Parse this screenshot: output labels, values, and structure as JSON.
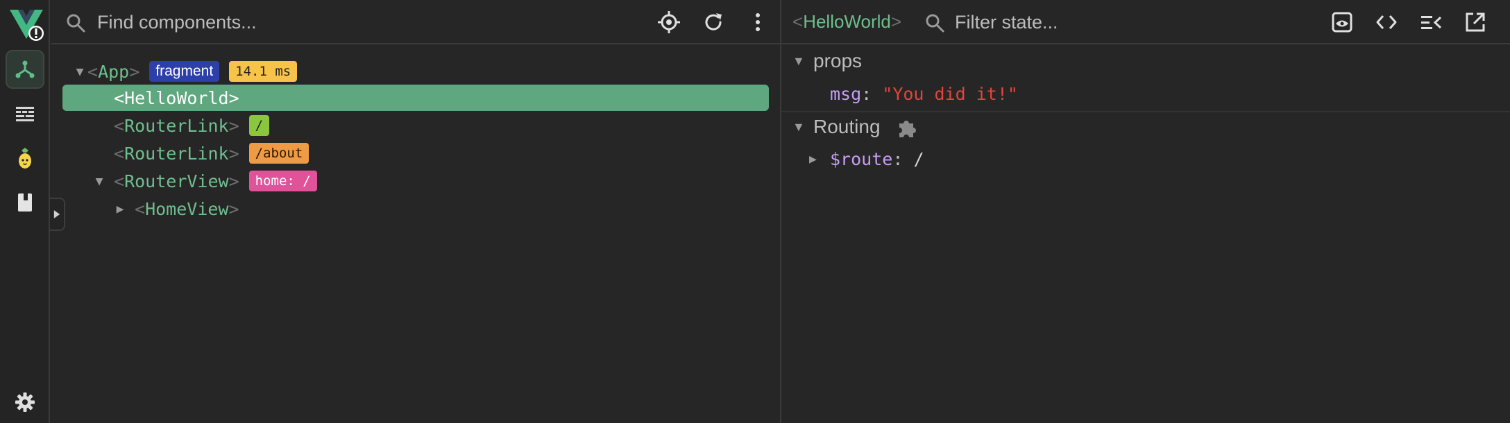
{
  "app": {
    "brand_color": "#42b883",
    "accent_green": "#5fa77e"
  },
  "activity_bar": {
    "items": [
      {
        "name": "components",
        "icon": "component-tree-icon",
        "active": true
      },
      {
        "name": "timeline",
        "icon": "timeline-icon",
        "active": false
      },
      {
        "name": "pinia",
        "icon": "pinia-icon",
        "active": false
      },
      {
        "name": "routes",
        "icon": "book-icon",
        "active": false
      },
      {
        "name": "settings",
        "icon": "gear-icon",
        "active": false
      }
    ]
  },
  "components_panel": {
    "search": {
      "placeholder": "Find components..."
    },
    "tree": [
      {
        "open": "<",
        "name": "App",
        "close": ">",
        "expanded": true,
        "badges": [
          {
            "text": "fragment",
            "kind": "fragment"
          },
          {
            "text": "14.1 ms",
            "kind": "time"
          }
        ]
      },
      {
        "open": "<",
        "name": "HelloWorld",
        "close": ">",
        "selected": true,
        "badges": []
      },
      {
        "open": "<",
        "name": "RouterLink",
        "close": ">",
        "badges": [
          {
            "text": "/",
            "kind": "green"
          }
        ]
      },
      {
        "open": "<",
        "name": "RouterLink",
        "close": ">",
        "badges": [
          {
            "text": "/about",
            "kind": "orange"
          }
        ]
      },
      {
        "open": "<",
        "name": "RouterView",
        "close": ">",
        "expanded": true,
        "badges": [
          {
            "text": "home: /",
            "kind": "pink"
          }
        ]
      },
      {
        "open": "<",
        "name": "HomeView",
        "close": ">",
        "expanded": false,
        "badges": []
      }
    ]
  },
  "state_panel": {
    "selected": {
      "open": "<",
      "name": "HelloWorld",
      "close": ">"
    },
    "filter": {
      "placeholder": "Filter state..."
    },
    "sections": [
      {
        "title": "props",
        "rows": [
          {
            "key": "msg",
            "colon": ":",
            "value": "\"You did it!\""
          }
        ]
      },
      {
        "title": "Routing",
        "rows": [
          {
            "key": "$route",
            "colon": ":",
            "value": "/"
          }
        ]
      }
    ]
  }
}
